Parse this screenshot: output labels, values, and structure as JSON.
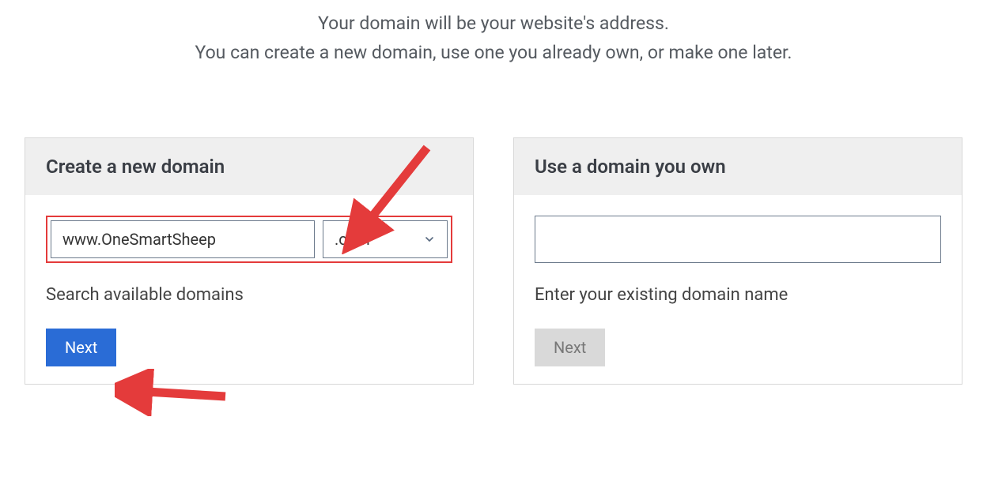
{
  "header": {
    "line1": "Your domain will be your website's address.",
    "line2": "You can create a new domain, use one you already own, or make one later."
  },
  "create": {
    "title": "Create a new domain",
    "domain_value": "www.OneSmartSheep",
    "tld_value": ".com",
    "hint": "Search available domains",
    "next_label": "Next"
  },
  "use_existing": {
    "title": "Use a domain you own",
    "domain_value": "",
    "hint": "Enter your existing domain name",
    "next_label": "Next"
  }
}
